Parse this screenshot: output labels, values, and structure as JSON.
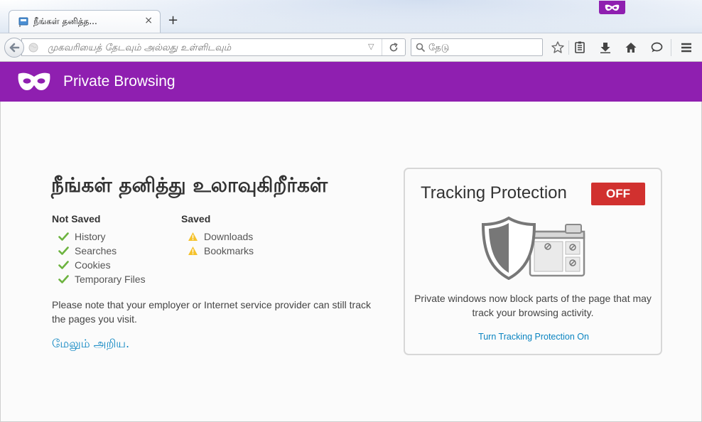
{
  "tab": {
    "title": "நீங்கள் தனித்த...",
    "close_glyph": "×",
    "new_tab_glyph": "+"
  },
  "navbar": {
    "url_placeholder": "முகவரியைத் தேடவும் அல்லது உள்ளிடவும்",
    "search_placeholder": "தேடு"
  },
  "header": {
    "title": "Private Browsing"
  },
  "main": {
    "heading": "நீங்கள் தனித்து உலாவுகிறீர்கள்",
    "not_saved": {
      "title": "Not Saved",
      "items": [
        "History",
        "Searches",
        "Cookies",
        "Temporary Files"
      ]
    },
    "saved": {
      "title": "Saved",
      "items": [
        "Downloads",
        "Bookmarks"
      ]
    },
    "note": "Please note that your employer or Internet service provider can still track the pages you visit.",
    "learn_more": "மேலும் அறிய."
  },
  "tracking_protection": {
    "title": "Tracking Protection",
    "status": "OFF",
    "description": "Private windows now block parts of the page that may track your browsing activity.",
    "link": "Turn Tracking Protection On"
  },
  "colors": {
    "private_purple": "#8f1fb0",
    "status_off_red": "#d1312f",
    "link_blue": "#0a84c1",
    "check_green": "#6cb33f",
    "warning_yellow": "#f5c22c"
  },
  "icons": {
    "not_saved_mark": "check-icon",
    "saved_mark": "warning-icon"
  }
}
